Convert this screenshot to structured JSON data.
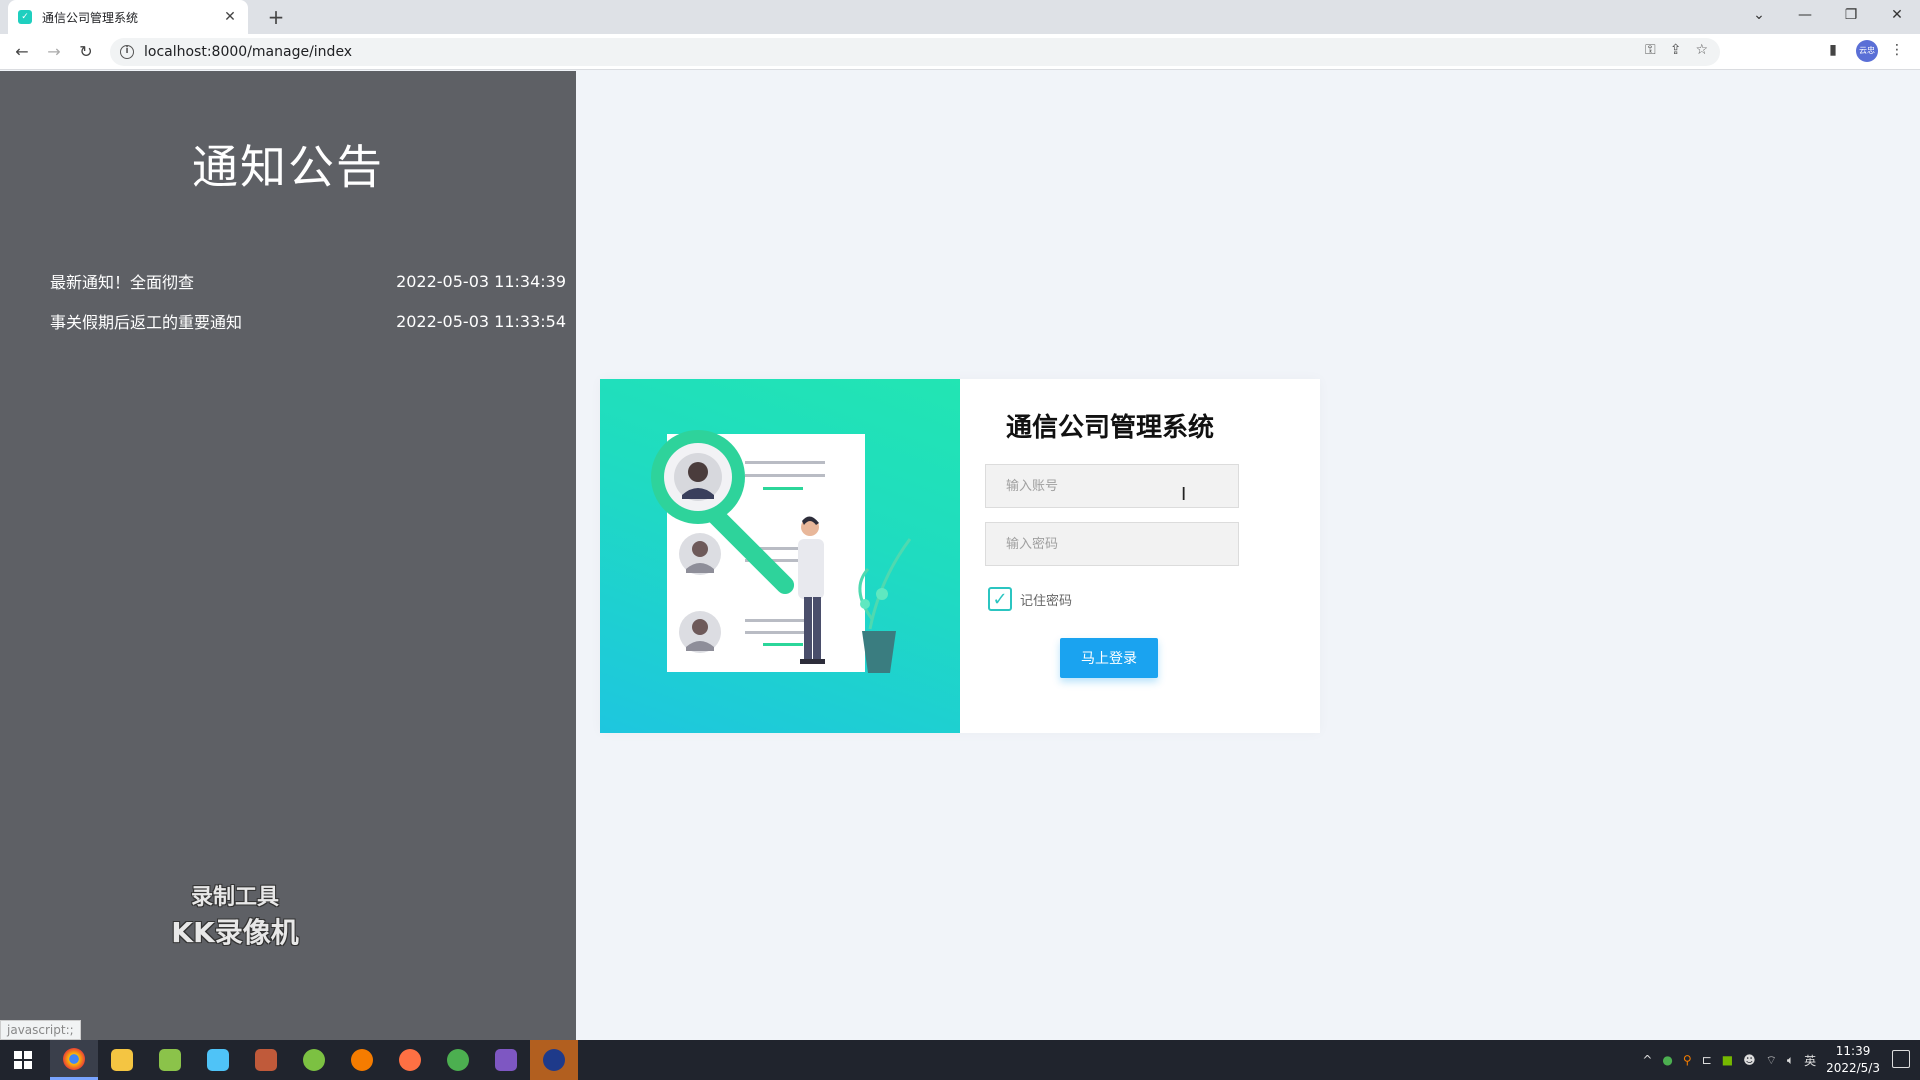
{
  "browser": {
    "tab_title": "通信公司管理系统",
    "url": "localhost:8000/manage/index",
    "profile_label": "云忠"
  },
  "notice": {
    "title": "通知公告",
    "items": [
      {
        "title": "最新通知！全面彻查",
        "time": "2022-05-03 11:34:39"
      },
      {
        "title": "事关假期后返工的重要通知",
        "time": "2022-05-03 11:33:54"
      }
    ]
  },
  "watermark": {
    "line1": "录制工具",
    "line2": "KK录像机"
  },
  "status_tip": "javascript:;",
  "login": {
    "title": "通信公司管理系统",
    "account_placeholder": "输入账号",
    "password_placeholder": "输入密码",
    "remember_label": "记住密码",
    "remember_checked": true,
    "submit_label": "马上登录"
  },
  "taskbar": {
    "time": "11:39",
    "date": "2022/5/3",
    "ime": "英"
  },
  "colors": {
    "notice_bg": "#5e6065",
    "page_bg": "#f1f4f9",
    "accent_teal": "#1fdcc0",
    "button_blue": "#1aa3f0"
  }
}
